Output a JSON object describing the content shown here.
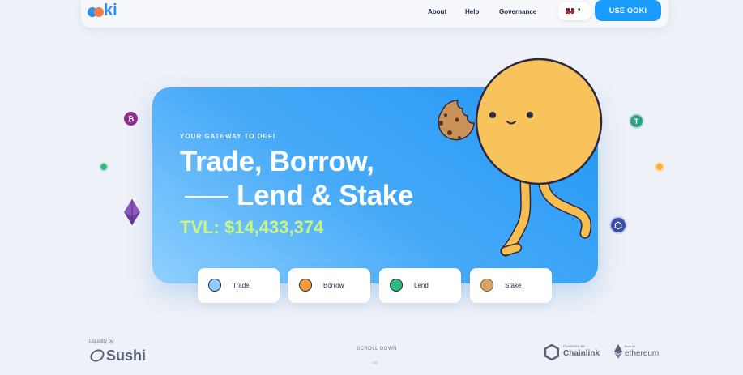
{
  "brand": {
    "logo_text": "ki",
    "accent": "#1a9bff"
  },
  "nav": {
    "about": "About",
    "help": "Help",
    "governance": "Governance"
  },
  "language": {
    "flag_icon": "uk-flag-icon"
  },
  "cta": {
    "label": "USE OOKI"
  },
  "hero": {
    "eyebrow": "YOUR GATEWAY TO DEFI",
    "title_line1": "Trade, Borrow,",
    "title_line2": "Lend & Stake",
    "tvl": "TVL: $14,433,374"
  },
  "features": [
    {
      "label": "Trade",
      "color": "#8fcbff"
    },
    {
      "label": "Borrow",
      "color": "#f59a3a"
    },
    {
      "label": "Lend",
      "color": "#2fba7c"
    },
    {
      "label": "Stake",
      "color": "#d9a66a"
    }
  ],
  "coins": [
    {
      "name": "bitcoin-coin-icon",
      "glyph": "₿"
    },
    {
      "name": "tether-coin-icon",
      "glyph": "T"
    },
    {
      "name": "chainlink-coin-icon",
      "glyph": "⬡"
    }
  ],
  "footer": {
    "liquidity_by": "Liquidity by:",
    "sushi": "Sushi",
    "scroll": "SCROLL DOWN",
    "chainlink_small": "POWERED BY",
    "chainlink": "Chainlink",
    "ethereum_small": "Built on",
    "ethereum": "ethereum"
  }
}
